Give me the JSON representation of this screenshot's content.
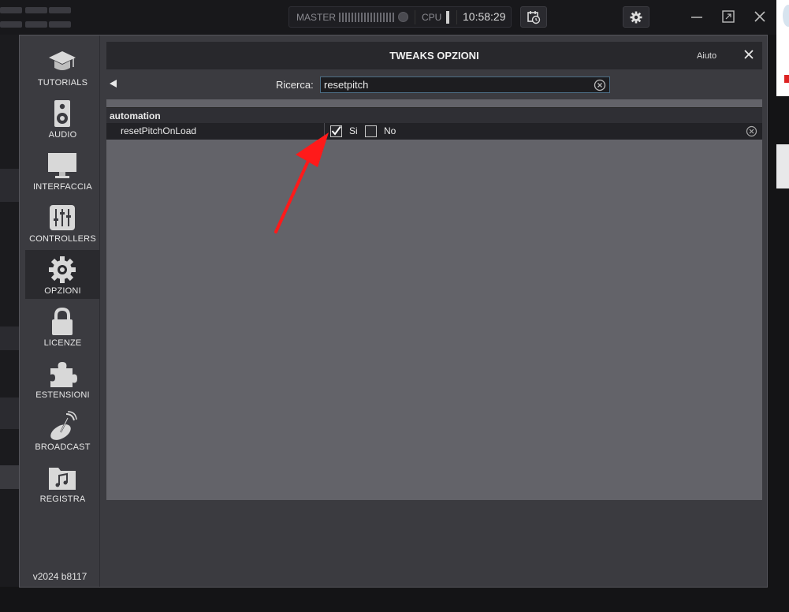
{
  "topbar": {
    "master_label": "MASTER",
    "cpu_label": "CPU",
    "time": "10:58:29",
    "icons": [
      "grid-menu-icon",
      "schedule-icon",
      "gear-icon",
      "minimize-icon",
      "maximize-icon",
      "close-icon"
    ]
  },
  "sidebar": {
    "items": [
      {
        "label": "TUTORIALS",
        "icon": "graduation-cap-icon"
      },
      {
        "label": "AUDIO",
        "icon": "speaker-icon"
      },
      {
        "label": "INTERFACCIA",
        "icon": "monitor-icon"
      },
      {
        "label": "CONTROLLERS",
        "icon": "sliders-icon"
      },
      {
        "label": "OPZIONI",
        "icon": "gear-icon",
        "active": true
      },
      {
        "label": "LICENZE",
        "icon": "lock-icon"
      },
      {
        "label": "ESTENSIONI",
        "icon": "puzzle-icon"
      },
      {
        "label": "BROADCAST",
        "icon": "satellite-dish-icon"
      },
      {
        "label": "REGISTRA",
        "icon": "music-folder-icon"
      }
    ],
    "version": "v2024 b8117"
  },
  "panel": {
    "title": "TWEAKS OPZIONI",
    "help_label": "Aiuto",
    "search": {
      "label": "Ricerca:",
      "value": "resetpitch"
    },
    "group": "automation",
    "option": {
      "name": "resetPitchOnLoad",
      "yes_label": "Si",
      "no_label": "No",
      "yes_checked": true,
      "no_checked": false
    }
  },
  "colors": {
    "accent_arrow": "#ff1a1a",
    "panel_bg": "#636369",
    "dialog_bg": "#3b3b40"
  }
}
